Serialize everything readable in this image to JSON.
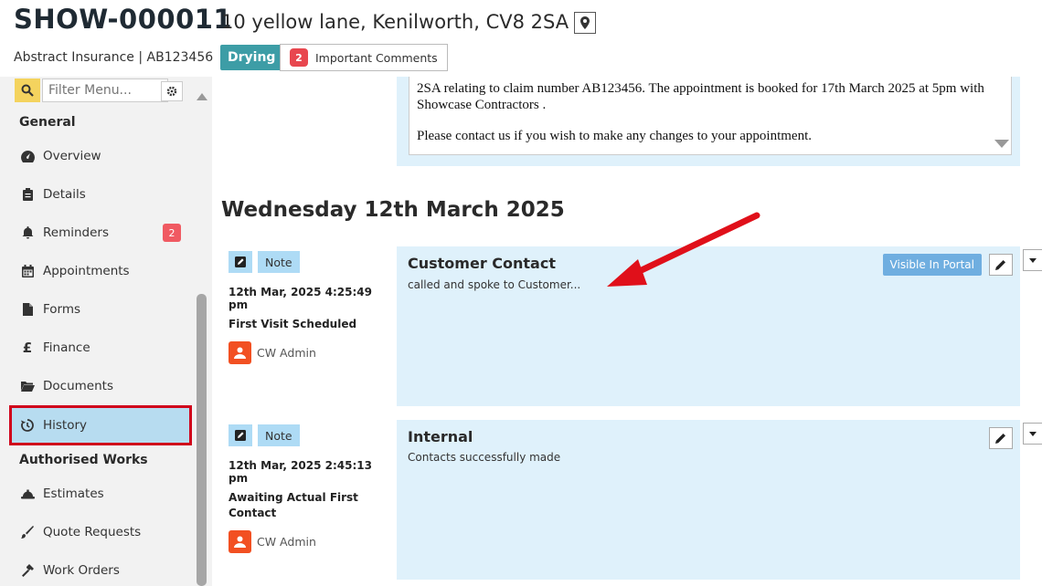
{
  "header": {
    "job_id": "SHOW-000011",
    "address": "10 yellow lane, Kenilworth, CV8 2SA",
    "insurer_line": "Abstract Insurance | AB123456",
    "status": "Drying",
    "comments_count": "2",
    "comments_label": "Important Comments"
  },
  "sidebar": {
    "filter_placeholder": "Filter Menu...",
    "general_heading": "General",
    "authorised_heading": "Authorised Works",
    "items": [
      {
        "label": "Overview",
        "icon": "dashboard-icon"
      },
      {
        "label": "Details",
        "icon": "clipboard-icon"
      },
      {
        "label": "Reminders",
        "icon": "bell-icon",
        "badge": "2"
      },
      {
        "label": "Appointments",
        "icon": "calendar-icon"
      },
      {
        "label": "Forms",
        "icon": "file-icon"
      },
      {
        "label": "Finance",
        "icon": "pound-icon"
      },
      {
        "label": "Documents",
        "icon": "folder-icon"
      },
      {
        "label": "History",
        "icon": "history-icon",
        "active": true
      },
      {
        "label": "Estimates",
        "icon": "hard-hat-icon"
      },
      {
        "label": "Quote Requests",
        "icon": "brush-icon"
      },
      {
        "label": "Work Orders",
        "icon": "hammer-icon"
      }
    ]
  },
  "email": {
    "line1": "2SA relating to claim number AB123456. The appointment is booked for 17th March 2025 at 5pm with Showcase Contractors .",
    "line2": "Please contact us if you wish to make any changes to your appointment."
  },
  "history": {
    "date_heading": "Wednesday 12th March 2025",
    "entries": [
      {
        "type": "Note",
        "time": "12th Mar, 2025 4:25:49 pm",
        "stage": "First Visit Scheduled",
        "user": "CW Admin",
        "title": "Customer Contact",
        "body": "called and spoke to Customer...",
        "portal_label": "Visible In Portal"
      },
      {
        "type": "Note",
        "time": "12th Mar, 2025 2:45:13 pm",
        "stage": "Awaiting Actual First Contact",
        "user": "CW Admin",
        "title": "Internal",
        "body": "Contacts successfully made"
      }
    ]
  },
  "colors": {
    "status": "#3d9da6",
    "card_bg": "#dff1fb",
    "tag_bg": "#aedbf5",
    "badge": "#f05a62",
    "avatar": "#f25022",
    "highlight": "#d0021b",
    "portal_button": "#6faee0"
  }
}
